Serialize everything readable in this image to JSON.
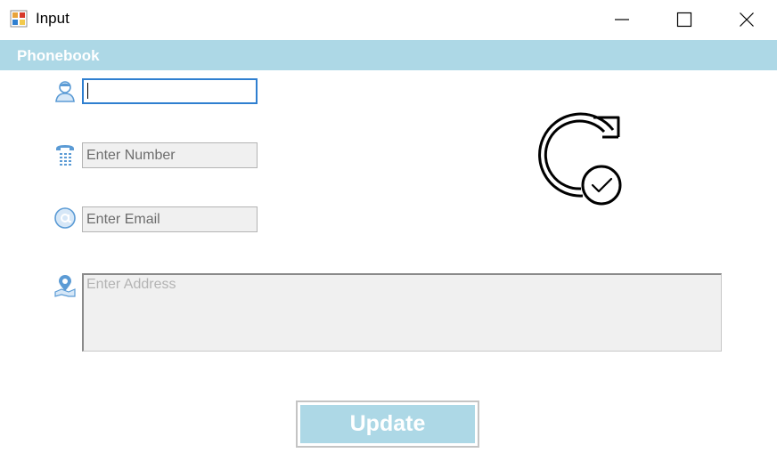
{
  "window": {
    "title": "Input"
  },
  "header": {
    "title": "Phonebook"
  },
  "form": {
    "name": {
      "value": "",
      "placeholder": ""
    },
    "number": {
      "placeholder": "Enter Number"
    },
    "email": {
      "placeholder": "Enter Email"
    },
    "address": {
      "placeholder": "Enter Address"
    }
  },
  "actions": {
    "update_label": "Update"
  },
  "icons": {
    "app": "form-app-icon",
    "name": "person-icon",
    "number": "telephone-icon",
    "email": "at-sign-icon",
    "address": "location-pin-icon",
    "hero": "refresh-check-icon"
  },
  "colors": {
    "accent": "#add8e6",
    "field_icon": "#5b9bd5",
    "focus_border": "#2f7fd0"
  }
}
